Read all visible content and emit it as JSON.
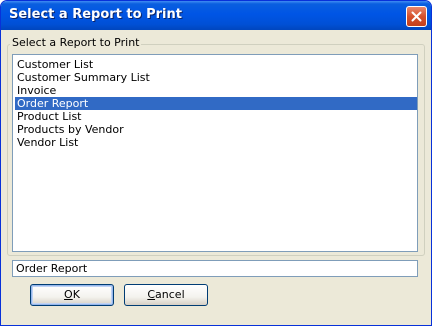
{
  "window": {
    "title": "Select a Report to Print"
  },
  "group": {
    "label": "Select a Report to Print"
  },
  "reports": {
    "items": [
      {
        "label": "Customer List",
        "selected": false
      },
      {
        "label": "Customer Summary List",
        "selected": false
      },
      {
        "label": "Invoice",
        "selected": false
      },
      {
        "label": "Order Report",
        "selected": true
      },
      {
        "label": "Product List",
        "selected": false
      },
      {
        "label": "Products by Vendor",
        "selected": false
      },
      {
        "label": "Vendor List",
        "selected": false
      }
    ]
  },
  "selection": {
    "value": "Order Report"
  },
  "buttons": {
    "ok": {
      "mnemonic": "O",
      "rest": "K"
    },
    "cancel": {
      "mnemonic": "C",
      "rest": "ancel"
    }
  },
  "colors": {
    "titlebar": "#0055e5",
    "selection_highlight": "#316ac5",
    "dialog_background": "#ece9d8"
  }
}
